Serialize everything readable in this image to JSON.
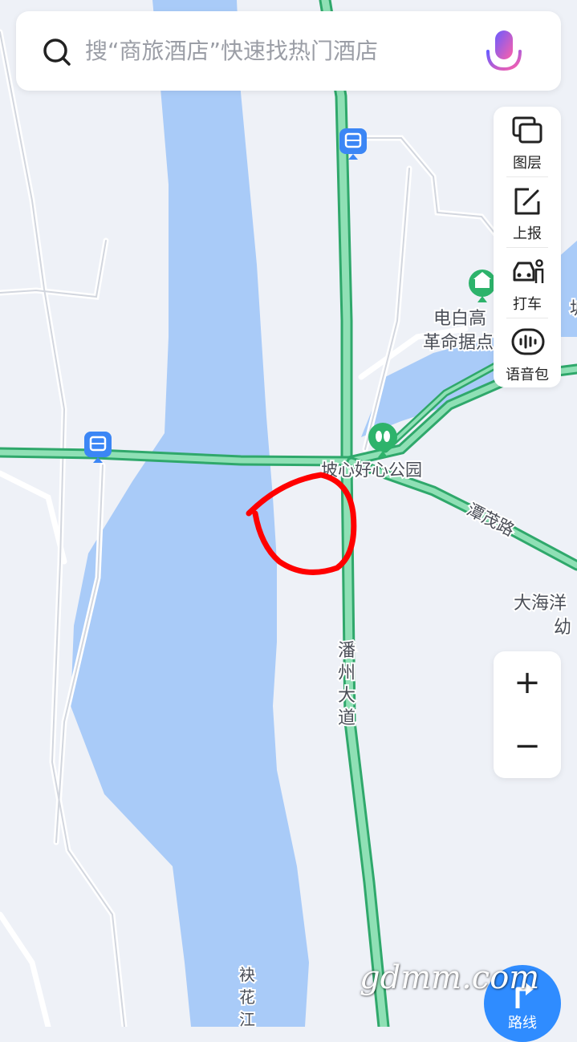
{
  "search": {
    "placeholder": "搜“商旅酒店”快速找热门酒店"
  },
  "tools": [
    {
      "label": "图层",
      "icon": "layers-icon"
    },
    {
      "label": "上报",
      "icon": "report-edit-icon"
    },
    {
      "label": "打车",
      "icon": "taxi-icon"
    },
    {
      "label": "语音包",
      "icon": "voice-pack-icon"
    }
  ],
  "zoom": {
    "in_label": "+",
    "out_label": "−"
  },
  "route": {
    "label": "路线",
    "icon": "route-arrow-icon"
  },
  "map": {
    "labels": {
      "poi_base_line1": "电白高",
      "poi_base_line2": "革命据点",
      "poi_park": "坡心好心公园",
      "road_tanmao": "潭茂路",
      "road_panzhou_1": "潘",
      "road_panzhou_2": "州",
      "road_panzhou_3": "大",
      "road_panzhou_4": "道",
      "poi_school_line1": "大海洋",
      "poi_school_line2": "幼",
      "river_1": "袂",
      "river_2": "花",
      "river_3": "江",
      "edge_char": "坡"
    },
    "colors": {
      "water": "#a9cbf8",
      "road_green": "#3dbb7e",
      "land": "#eef1f7",
      "annotation": "#ff0000",
      "poi_green": "#2db36b",
      "bus_blue": "#3b86f5"
    }
  },
  "watermark": "gdmm.com"
}
